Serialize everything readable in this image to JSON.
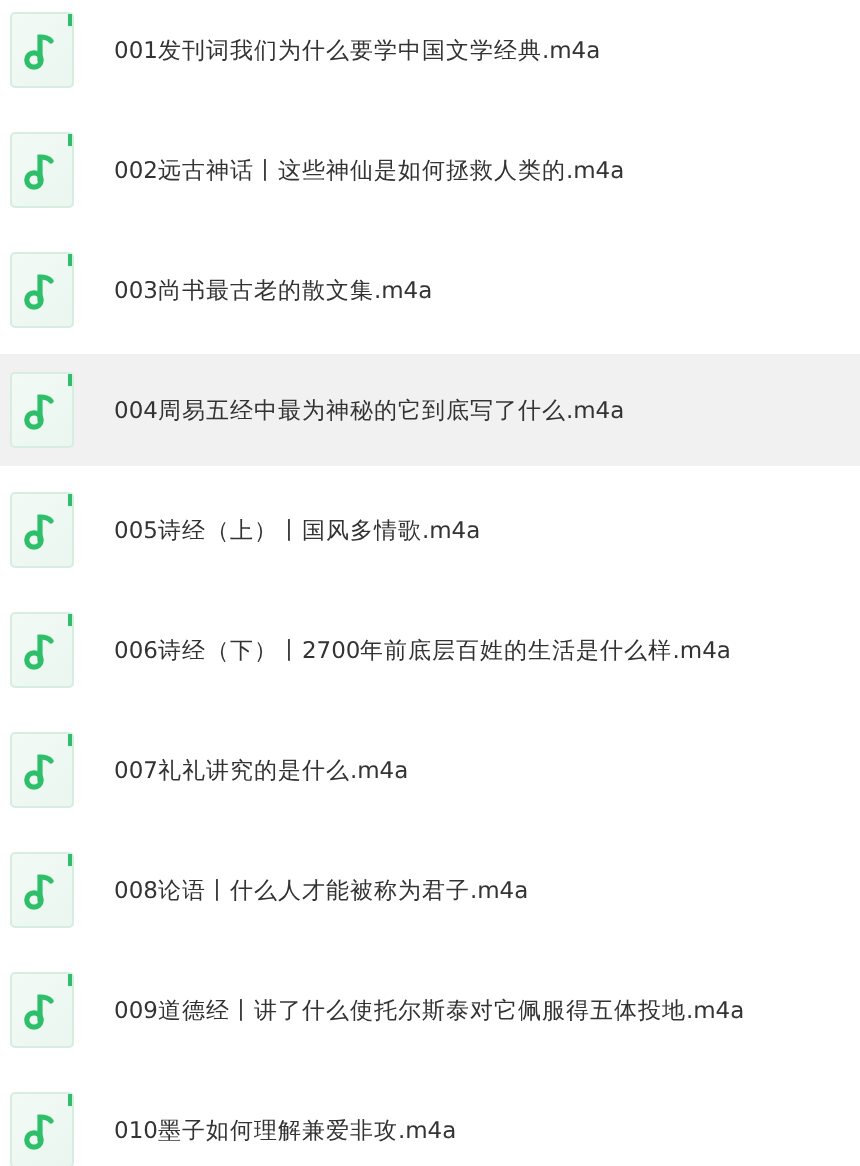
{
  "files": [
    {
      "name": "001发刊词我们为什么要学中国文学经典.m4a",
      "selected": false
    },
    {
      "name": "002远古神话丨这些神仙是如何拯救人类的.m4a",
      "selected": false
    },
    {
      "name": "003尚书最古老的散文集.m4a",
      "selected": false
    },
    {
      "name": "004周易五经中最为神秘的它到底写了什么.m4a",
      "selected": true
    },
    {
      "name": "005诗经（上）丨国风多情歌.m4a",
      "selected": false
    },
    {
      "name": "006诗经（下）丨2700年前底层百姓的生活是什么样.m4a",
      "selected": false
    },
    {
      "name": "007礼礼讲究的是什么.m4a",
      "selected": false
    },
    {
      "name": "008论语丨什么人才能被称为君子.m4a",
      "selected": false
    },
    {
      "name": "009道德经丨讲了什么使托尔斯泰对它佩服得五体投地.m4a",
      "selected": false
    },
    {
      "name": "010墨子如何理解兼爱非攻.m4a",
      "selected": false
    }
  ]
}
